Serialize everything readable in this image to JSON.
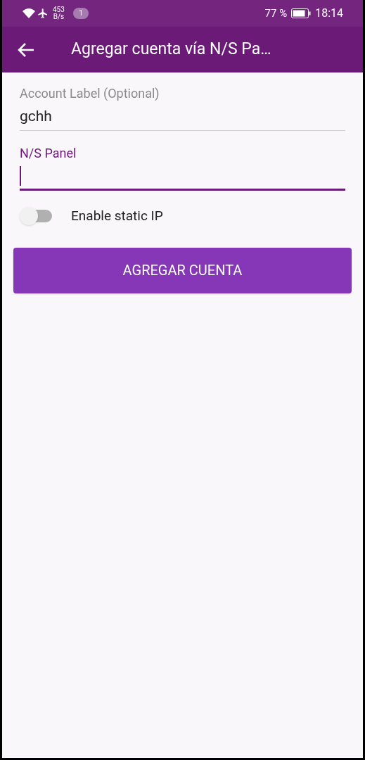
{
  "status_bar": {
    "speed_value": "453",
    "speed_unit": "B/s",
    "notification_count": "1",
    "battery_percent": "77 %",
    "time": "18:14"
  },
  "app_bar": {
    "title": "Agregar cuenta vía N/S Pa…"
  },
  "fields": [
    {
      "label": "Account Label (Optional)",
      "value": "gchh",
      "focused": false
    },
    {
      "label": "N/S Panel",
      "focused": true
    }
  ],
  "switch": {
    "label": "Enable static IP",
    "on": false
  },
  "button": {
    "label": "AGREGAR CUENTA"
  }
}
